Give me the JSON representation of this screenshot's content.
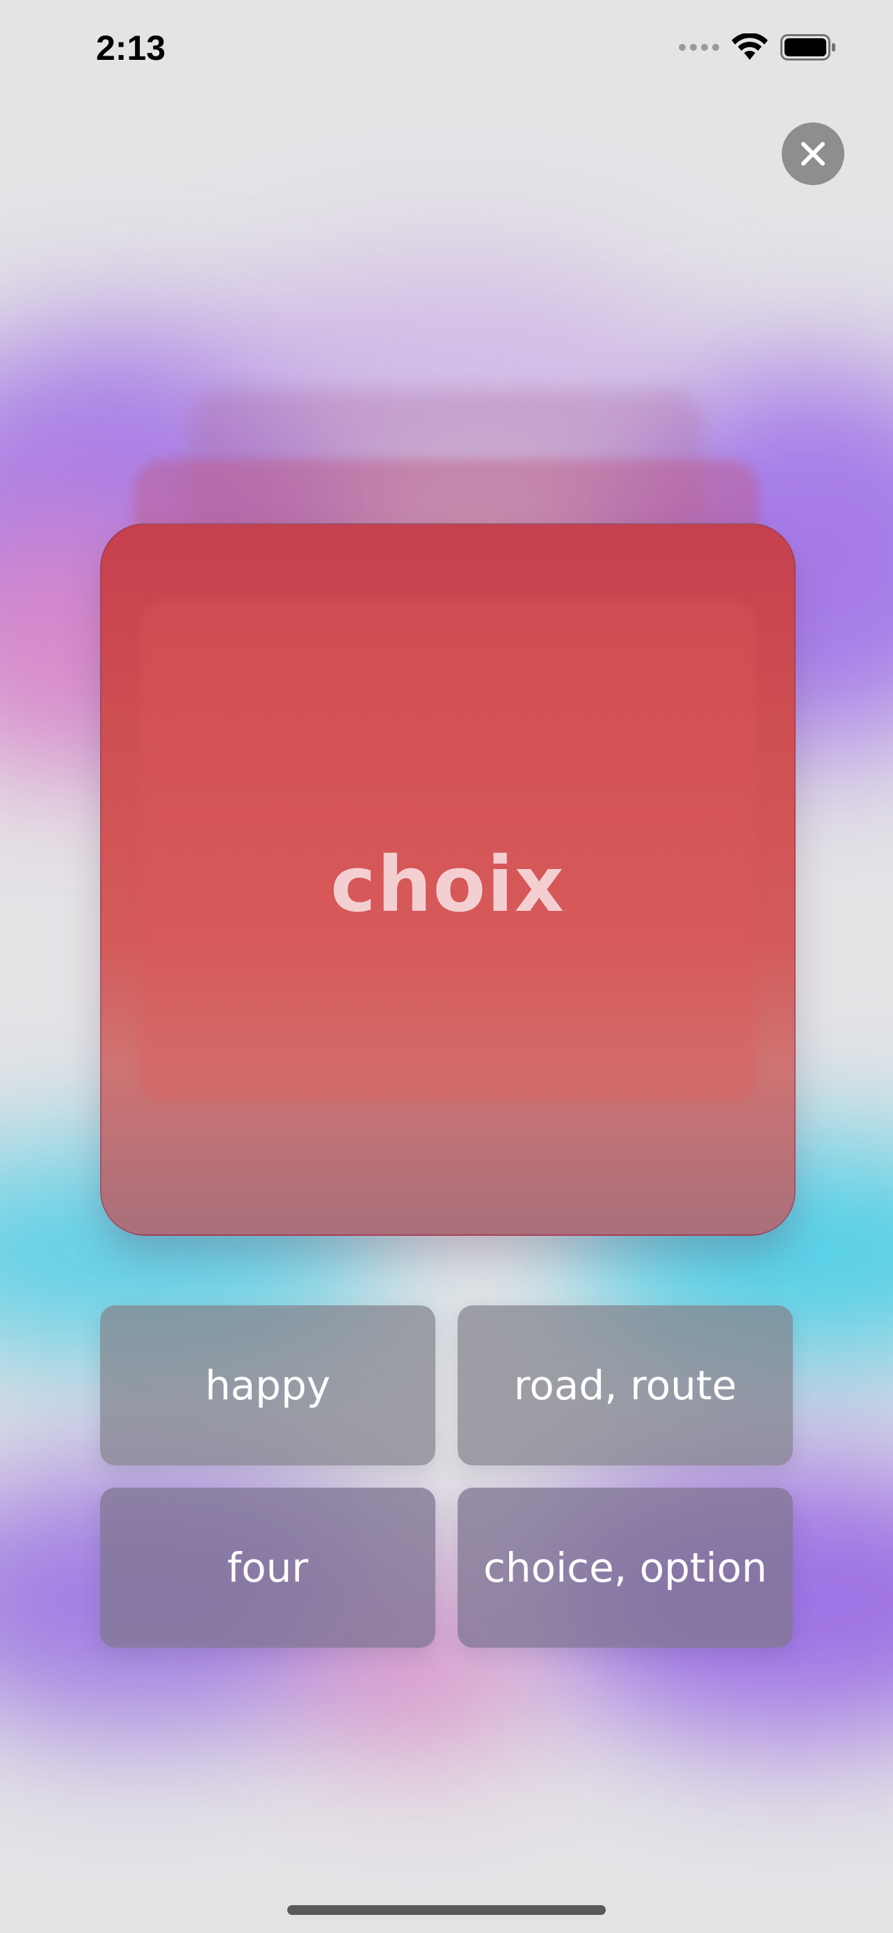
{
  "status_bar": {
    "time": "2:13",
    "icons": [
      "signal-dots-icon",
      "wifi-icon",
      "battery-icon"
    ]
  },
  "close_icon": "close-icon",
  "card": {
    "word": "choix"
  },
  "options": [
    {
      "label": "happy"
    },
    {
      "label": "road, route"
    },
    {
      "label": "four"
    },
    {
      "label": "choice, option"
    }
  ],
  "colors": {
    "card": "#cf5052",
    "option_button": "#8a8a94",
    "close_button": "#8e8e8e",
    "background": "#e4e3e6"
  }
}
